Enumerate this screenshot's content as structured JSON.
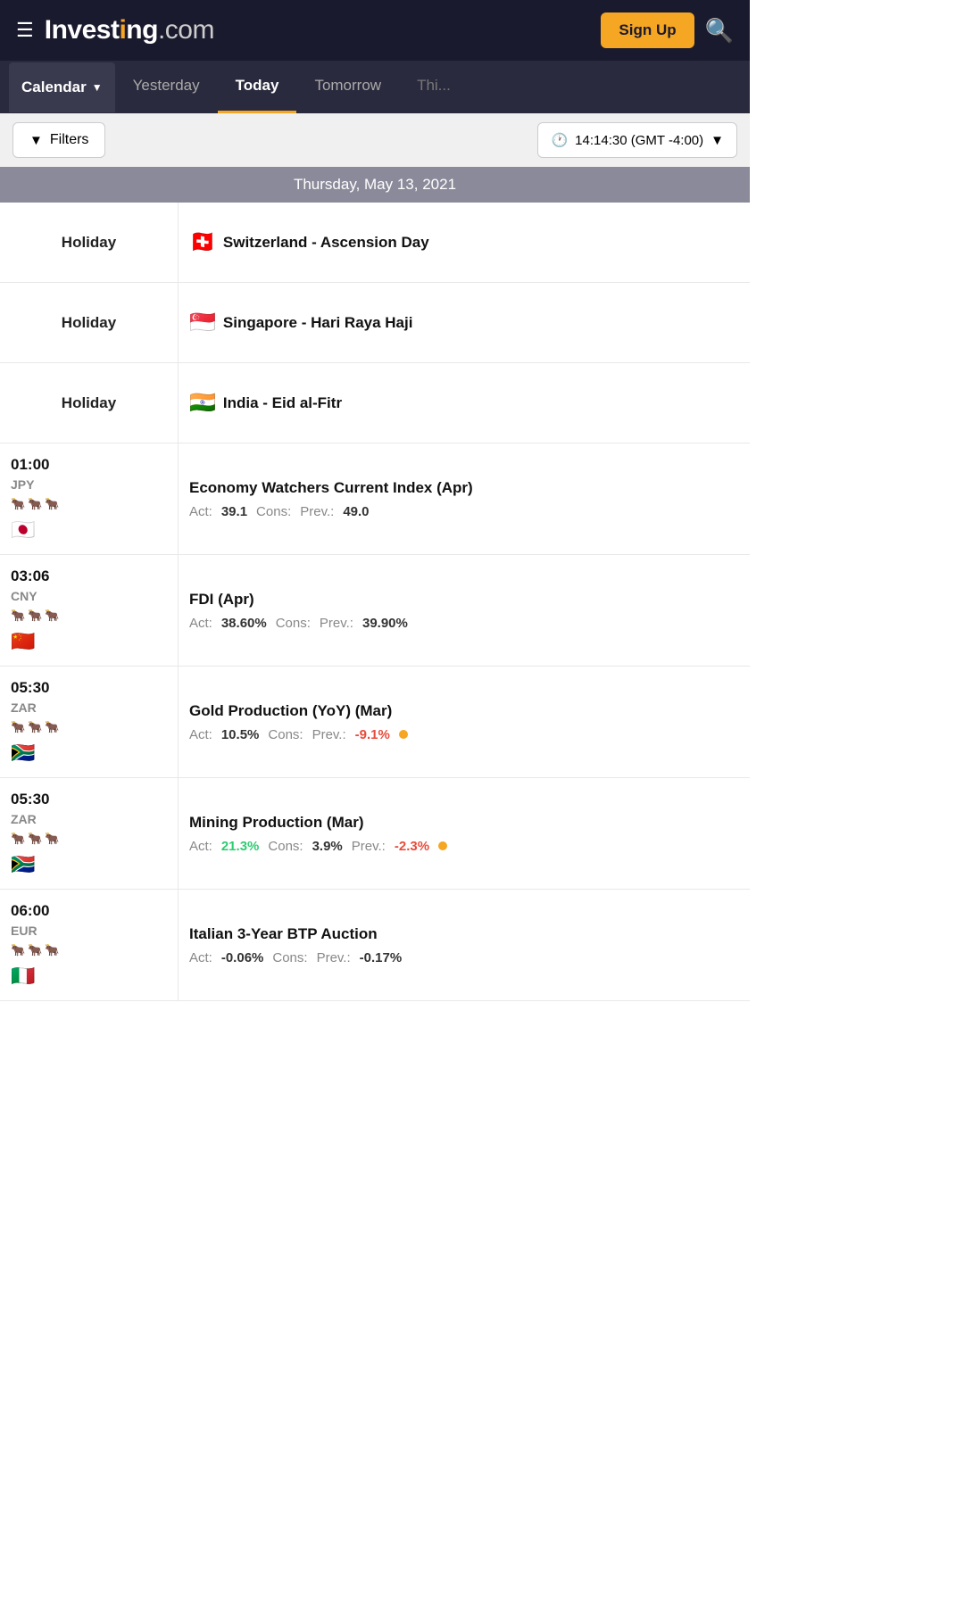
{
  "header": {
    "logo_investing": "Investing",
    "logo_dotcom": ".com",
    "signup_label": "Sign Up",
    "menu_icon": "☰",
    "search_icon": "🔍"
  },
  "nav": {
    "calendar_label": "Calendar",
    "tabs": [
      {
        "id": "yesterday",
        "label": "Yesterday",
        "active": false
      },
      {
        "id": "today",
        "label": "Today",
        "active": true
      },
      {
        "id": "tomorrow",
        "label": "Tomorrow",
        "active": false
      },
      {
        "id": "thisweek",
        "label": "Thi...",
        "active": false
      }
    ]
  },
  "toolbar": {
    "filters_label": "Filters",
    "time_label": "14:14:30 (GMT -4:00)"
  },
  "date_header": "Thursday, May 13, 2021",
  "events": [
    {
      "type": "holiday",
      "label": "Holiday",
      "flag": "🇨🇭",
      "name": "Switzerland - Ascension Day",
      "stats": null
    },
    {
      "type": "holiday",
      "label": "Holiday",
      "flag": "🇸🇬",
      "name": "Singapore - Hari Raya Haji",
      "stats": null
    },
    {
      "type": "holiday",
      "label": "Holiday",
      "flag": "🇮🇳",
      "name": "India - Eid al-Fitr",
      "stats": null
    },
    {
      "type": "event",
      "time": "01:00",
      "currency": "JPY",
      "flag": "🇯🇵",
      "impact": 1,
      "name": "Economy Watchers Current Index (Apr)",
      "act": "39.1",
      "act_color": "normal",
      "cons": "",
      "prev": "49.0",
      "prev_color": "normal",
      "dot": false
    },
    {
      "type": "event",
      "time": "03:06",
      "currency": "CNY",
      "flag": "🇨🇳",
      "impact": 1,
      "name": "FDI (Apr)",
      "act": "38.60%",
      "act_color": "normal",
      "cons": "",
      "prev": "39.90%",
      "prev_color": "normal",
      "dot": false
    },
    {
      "type": "event",
      "time": "05:30",
      "currency": "ZAR",
      "flag": "🇿🇦",
      "impact": 1,
      "name": "Gold Production (YoY) (Mar)",
      "act": "10.5%",
      "act_color": "normal",
      "cons": "",
      "prev": "-9.1%",
      "prev_color": "red",
      "dot": true
    },
    {
      "type": "event",
      "time": "05:30",
      "currency": "ZAR",
      "flag": "🇿🇦",
      "impact": 1,
      "name": "Mining Production (Mar)",
      "act": "21.3%",
      "act_color": "green",
      "cons": "3.9%",
      "cons_color": "normal",
      "prev": "-2.3%",
      "prev_color": "red",
      "dot": true
    },
    {
      "type": "event",
      "time": "06:00",
      "currency": "EUR",
      "flag": "🇮🇹",
      "impact": 1,
      "name": "Italian 3-Year BTP Auction",
      "act": "-0.06%",
      "act_color": "normal",
      "cons": "",
      "prev": "-0.17%",
      "prev_color": "normal",
      "dot": false
    }
  ]
}
